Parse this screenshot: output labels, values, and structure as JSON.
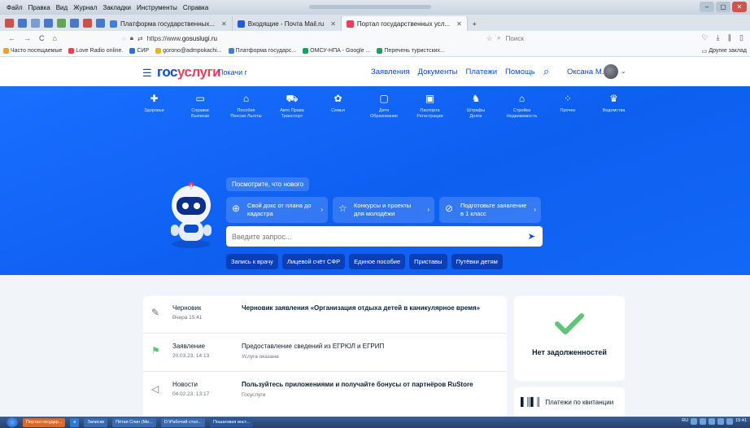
{
  "browser": {
    "menu": [
      "Файл",
      "Правка",
      "Вид",
      "Журнал",
      "Закладки",
      "Инструменты",
      "Справка"
    ],
    "tabs": [
      {
        "label": "Платформа государственных...",
        "color": "#3f7fd9",
        "active": false
      },
      {
        "label": "Входящие - Почта Mail.ru",
        "color": "#1f5fd0",
        "active": false
      },
      {
        "label": "Портал государственных усл...",
        "color": "#ee3f58",
        "active": true
      }
    ],
    "new_tab": "+",
    "url": {
      "prefix": "https://www.",
      "domain": "gosuslugi.ru"
    },
    "search_placeholder": "Поиск",
    "bookmarks": [
      {
        "label": "Часто посещаемые",
        "color": "#e6a13a"
      },
      {
        "label": "Love Radio online.",
        "color": "#e9414e"
      },
      {
        "label": "СИР",
        "color": "#2a6fd6"
      },
      {
        "label": "gorono@admpokachi...",
        "color": "#f0b400"
      },
      {
        "label": "Платформа государс...",
        "color": "#3f7fd9"
      },
      {
        "label": "ОМСУ-НПА - Google ...",
        "color": "#1aa15f"
      },
      {
        "label": "Перечень туристских...",
        "color": "#1aa15f"
      }
    ],
    "other_bookmarks": "Другие заклад"
  },
  "header": {
    "logo_a": "гос",
    "logo_b": "услуги",
    "region": "Покачи г",
    "nav": [
      "Заявления",
      "Документы",
      "Платежи",
      "Помощь"
    ],
    "user": "Оксана М."
  },
  "categories": [
    {
      "icon": "✚",
      "l1": "Здоровье",
      "l2": ""
    },
    {
      "icon": "▭",
      "l1": "Справки",
      "l2": "Выписки"
    },
    {
      "icon": "⌂",
      "l1": "Пособия",
      "l2": "Пенсии Льготы"
    },
    {
      "icon": "⛟",
      "l1": "Авто Права",
      "l2": "Транспорт"
    },
    {
      "icon": "✿",
      "l1": "Семья",
      "l2": ""
    },
    {
      "icon": "▢",
      "l1": "Дети",
      "l2": "Образование"
    },
    {
      "icon": "▣",
      "l1": "Паспорта",
      "l2": "Регистрация"
    },
    {
      "icon": "♞",
      "l1": "Штрафы",
      "l2": "Долги"
    },
    {
      "icon": "⌂",
      "l1": "Стройка",
      "l2": "Недвижимость"
    },
    {
      "icon": "⁘",
      "l1": "Прочее",
      "l2": ""
    },
    {
      "icon": "♛",
      "l1": "Ведомства",
      "l2": ""
    }
  ],
  "whats_new": "Посмотрите, что нового",
  "promos": [
    {
      "icon": "⊕",
      "text": "Свой докс от плана до кадастра",
      "arrow": "›"
    },
    {
      "icon": "☆",
      "text": "Конкурсы и проекты для молодёжи",
      "arrow": "›"
    },
    {
      "icon": "⊘",
      "text": "Подготовьте заявление в 1 класс",
      "arrow": "›"
    }
  ],
  "search": {
    "placeholder": "Введите запрос...",
    "send": "➤"
  },
  "quick": [
    "Запись к врачу",
    "Лицевой счёт СФР",
    "Единое пособие",
    "Приставы",
    "Путёвки детям"
  ],
  "feed": [
    {
      "icon": "✎",
      "type": "Черновик",
      "date": "Вчера 15:41",
      "title": "Черновик заявления «Организация отдыха детей в каникулярное время»",
      "sub": "",
      "bold": true
    },
    {
      "icon": "⚑",
      "type": "Заявление",
      "date": "20.03.23, 14:13",
      "title": "Предоставление сведений из ЕГРЮЛ и ЕГРИП",
      "sub": "Услуга оказана",
      "bold": false
    },
    {
      "icon": "◁",
      "type": "Новости",
      "date": "04.02.23, 13:17",
      "title": "Пользуйтесь приложениями и получайте бонусы от партнёров RuStore",
      "sub": "Госуслуги",
      "bold": true
    }
  ],
  "debt": "Нет задолженностей",
  "pay": {
    "icon": "▌║▌║",
    "label": "Платежи по квитанции"
  },
  "colors": {
    "brand": "#0d4cd3",
    "hero": "#1468f6",
    "check": "#5fc47a",
    "logo_red": "#ee3f58"
  },
  "taskbar": {
    "items": [
      "Портал государ...",
      "Записки",
      "Пётая Спин (Ми...",
      "D:\\Рабочий стол...",
      "Пошаговая инст..."
    ],
    "lang": "RU",
    "time": "15:41"
  }
}
